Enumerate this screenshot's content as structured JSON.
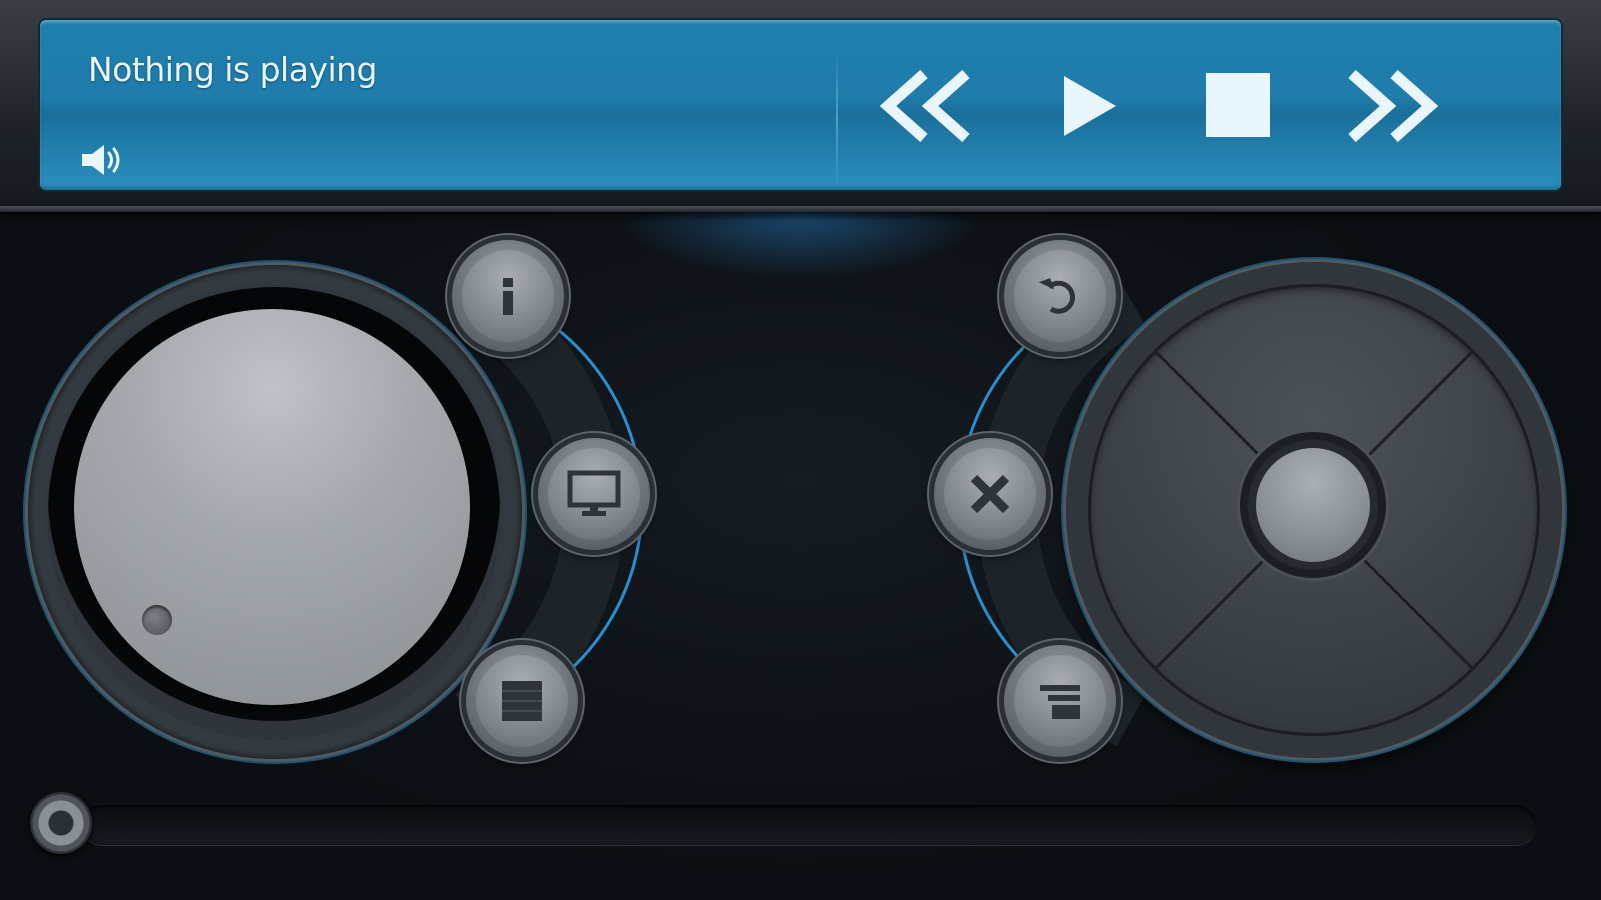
{
  "now_playing": {
    "status_text": "Nothing is playing",
    "volume_icon": "speaker-volume-icon"
  },
  "transport": {
    "buttons": [
      {
        "name": "rewind-button",
        "icon": "double-chevron-left-icon"
      },
      {
        "name": "play-button",
        "icon": "play-icon"
      },
      {
        "name": "stop-button",
        "icon": "stop-square-icon"
      },
      {
        "name": "fast-forward-button",
        "icon": "double-chevron-right-icon"
      }
    ]
  },
  "left_controls": {
    "dial": "volume-knob",
    "buttons": [
      {
        "name": "info-button",
        "icon": "info-icon"
      },
      {
        "name": "display-button",
        "icon": "monitor-icon"
      },
      {
        "name": "menu-button",
        "icon": "menu-grid-icon"
      }
    ]
  },
  "right_controls": {
    "dpad": "navigation-dpad",
    "buttons": [
      {
        "name": "back-button",
        "icon": "undo-arrow-icon"
      },
      {
        "name": "close-button",
        "icon": "x-icon"
      },
      {
        "name": "playlist-button",
        "icon": "list-lines-icon"
      }
    ]
  },
  "progress": {
    "position": 0
  },
  "colors": {
    "accent_blue": "#1e7fae",
    "arc_blue": "#2a8fd0",
    "background": "#0d1115"
  }
}
